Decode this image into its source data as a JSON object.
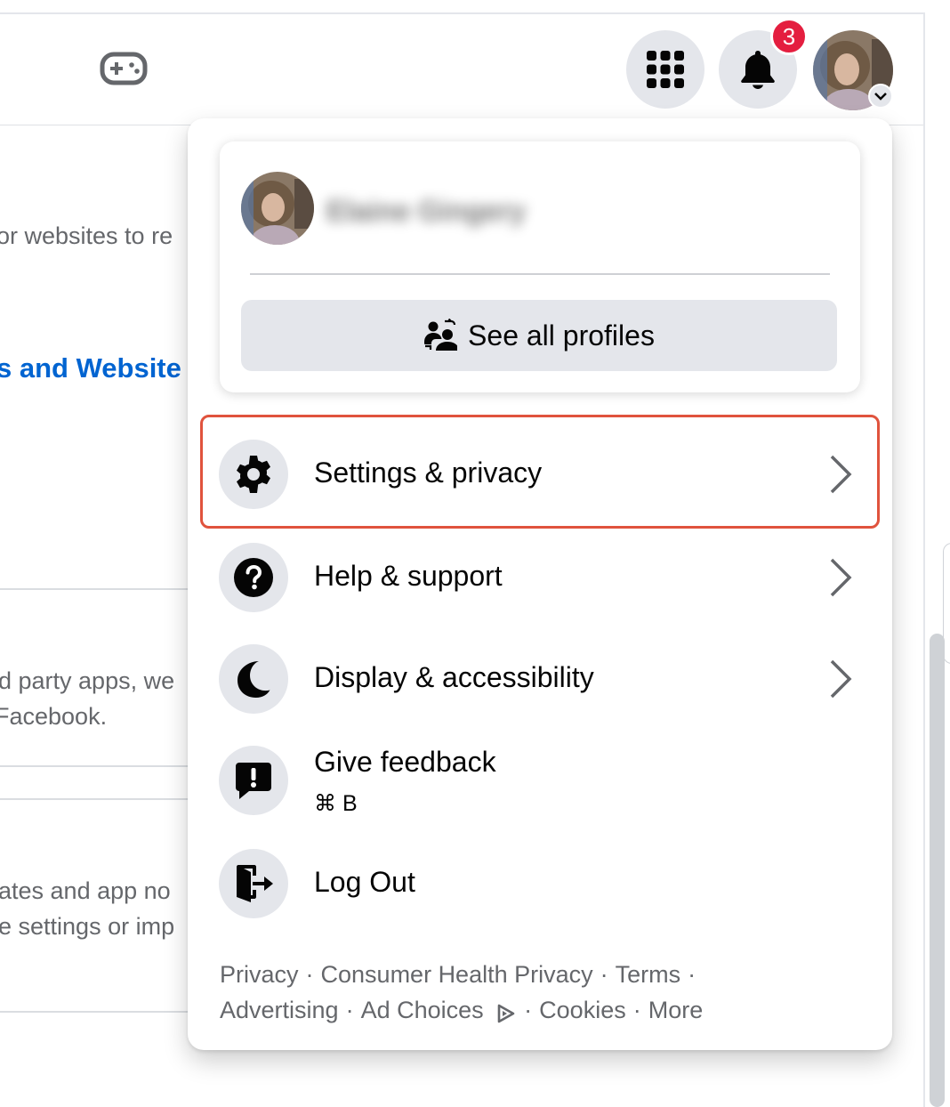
{
  "header": {
    "notifications_count": "3"
  },
  "background": {
    "line1": "or websites to re",
    "link": "s and Website",
    "line2a": "d party apps, we",
    "line2b": "Facebook.",
    "line3a": "ates and app no",
    "line3b": "e settings or imp"
  },
  "account_menu": {
    "profile_name": "Elaine Gingery",
    "see_all_profiles": "See all profiles",
    "items": [
      {
        "label": "Settings & privacy",
        "icon": "gear-icon",
        "has_chevron": true,
        "highlighted": true
      },
      {
        "label": "Help & support",
        "icon": "question-icon",
        "has_chevron": true
      },
      {
        "label": "Display & accessibility",
        "icon": "moon-icon",
        "has_chevron": true
      },
      {
        "label": "Give feedback",
        "shortcut": "⌘ B",
        "icon": "feedback-icon",
        "has_chevron": false
      },
      {
        "label": "Log Out",
        "icon": "logout-icon",
        "has_chevron": false
      }
    ],
    "footer_links": [
      "Privacy",
      "Consumer Health Privacy",
      "Terms",
      "Advertising",
      "Ad Choices",
      "Cookies",
      "More"
    ],
    "footer_separator": "·"
  },
  "colors": {
    "highlight": "#e0533d",
    "badge": "#e41e3f",
    "link": "#0064d1",
    "button_bg": "#e4e6eb"
  }
}
